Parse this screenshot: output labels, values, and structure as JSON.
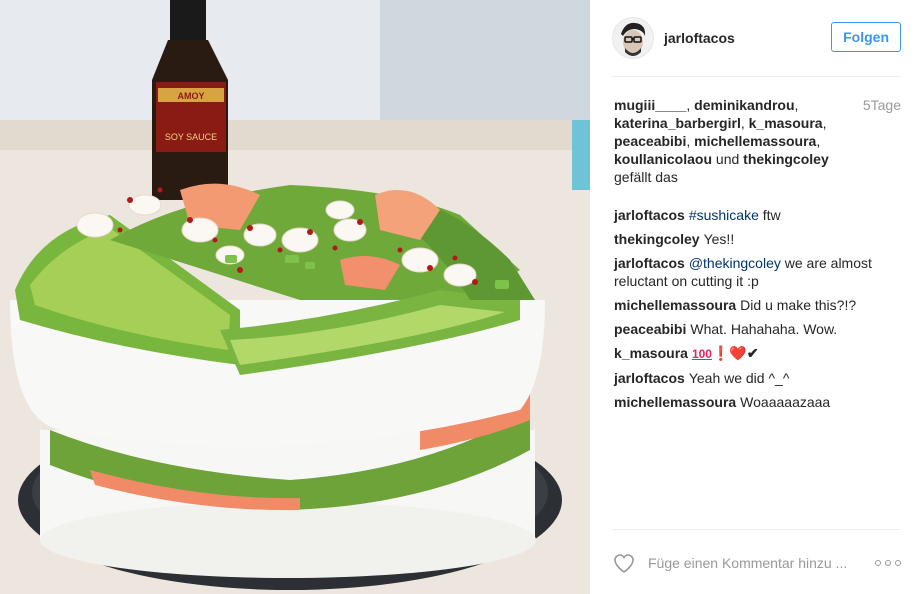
{
  "post": {
    "photo_label": "SOY SAUCE",
    "bottle_brand": "AMOY"
  },
  "header": {
    "username": "jarloftacos",
    "follow_label": "Folgen"
  },
  "likes": {
    "names": [
      "mugiii____",
      "deminikandrou",
      "katerina_barbergirl",
      "k_masoura",
      "peaceabibi",
      "michellemassoura",
      "koullanicolaou"
    ],
    "conjunction": "und",
    "last_name": "thekingcoley",
    "suffix": "gefällt das"
  },
  "timestamp": "5Tage",
  "comments": [
    {
      "author": "jarloftacos",
      "tag": "#sushicake",
      "text": " ftw"
    },
    {
      "author": "thekingcoley",
      "tag": "",
      "text": "Yes!!"
    },
    {
      "author": "jarloftacos",
      "tag": "@thekingcoley",
      "text": " we are almost reluctant on cutting it :p"
    },
    {
      "author": "michellemassoura",
      "tag": "",
      "text": "Did u make this?!?"
    },
    {
      "author": "peaceabibi",
      "tag": "",
      "text": "What. Hahahaha. Wow."
    },
    {
      "author": "k_masoura",
      "tag": "",
      "text": ""
    },
    {
      "author": "jarloftacos",
      "tag": "",
      "text": "Yeah we did ^_^"
    },
    {
      "author": "michellemassoura",
      "tag": "",
      "text": "Woaaaaazaaa"
    }
  ],
  "k_masoura_emojis": {
    "hundred": "100",
    "exclamation": "❗",
    "heart": "❤️",
    "check": "✔"
  },
  "add_comment": {
    "placeholder": "Füge einen Kommentar hinzu ..."
  },
  "icons": {
    "like": "heart-icon",
    "more": "more-options-icon"
  },
  "colors": {
    "link": "#3897f0",
    "tag": "#003569",
    "muted": "#999999"
  }
}
